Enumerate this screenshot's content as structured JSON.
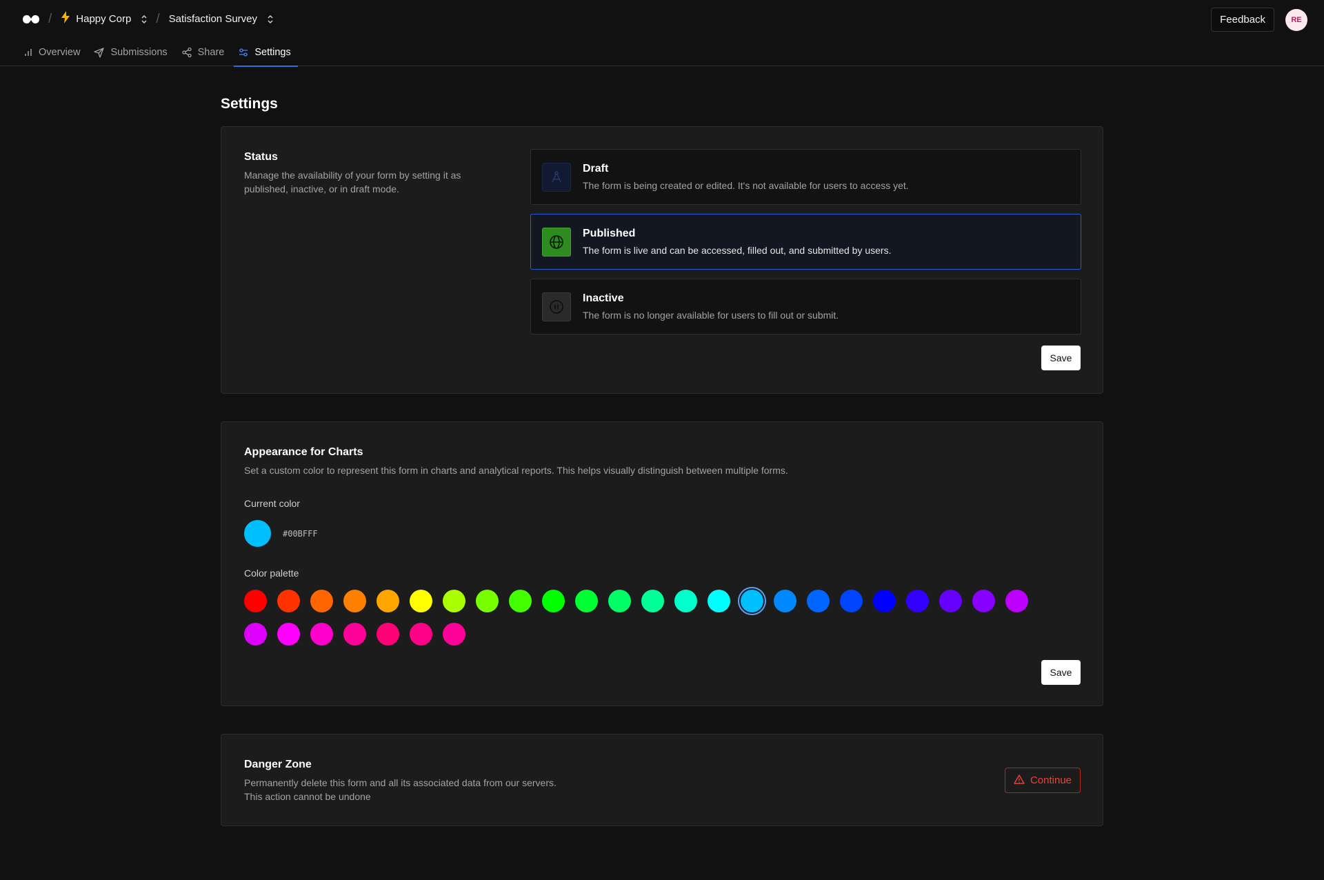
{
  "header": {
    "logo_icon": "infinity-logo-icon",
    "org": {
      "icon": "bolt-icon",
      "name": "Happy Corp"
    },
    "form": {
      "name": "Satisfaction Survey"
    },
    "feedback_label": "Feedback",
    "avatar_initials": "RE"
  },
  "tabs": [
    {
      "label": "Overview",
      "icon": "bar-chart-icon",
      "active": false
    },
    {
      "label": "Submissions",
      "icon": "send-icon",
      "active": false
    },
    {
      "label": "Share",
      "icon": "share-icon",
      "active": false
    },
    {
      "label": "Settings",
      "icon": "settings-sliders-icon",
      "active": true
    }
  ],
  "page_title": "Settings",
  "status": {
    "title": "Status",
    "description": "Manage the availability of your form by setting it as published, inactive, or in draft mode.",
    "options": [
      {
        "title": "Draft",
        "description": "The form is being created or edited. It's not available for users to access yet.",
        "icon": "compass-icon",
        "selected": false
      },
      {
        "title": "Published",
        "description": "The form is live and can be accessed, filled out, and submitted by users.",
        "icon": "globe-icon",
        "selected": true
      },
      {
        "title": "Inactive",
        "description": "The form is no longer available for users to fill out or submit.",
        "icon": "pause-circle-icon",
        "selected": false
      }
    ],
    "save_label": "Save"
  },
  "appearance": {
    "title": "Appearance for Charts",
    "description": "Set a custom color to represent this form in charts and analytical reports. This helps visually distinguish between multiple forms.",
    "current_color_label": "Current color",
    "current_color": "#00BFFF",
    "palette_label": "Color palette",
    "palette": [
      "#FF0000",
      "#FF3300",
      "#FF6600",
      "#FF8000",
      "#FFA500",
      "#FFFF00",
      "#AAFF00",
      "#77FF00",
      "#44FF00",
      "#00FF00",
      "#00FF33",
      "#00FF66",
      "#00FF99",
      "#00FFCC",
      "#00FFFF",
      "#00BFFF",
      "#0088FF",
      "#0066FF",
      "#0044FF",
      "#0000FF",
      "#3300FF",
      "#6600FF",
      "#8800FF",
      "#BB00FF",
      "#DD00FF",
      "#FF00FF",
      "#FF00CC",
      "#FF0099",
      "#FF0077",
      "#FF0088",
      "#FF0099"
    ],
    "selected_index": 15,
    "save_label": "Save"
  },
  "danger": {
    "title": "Danger Zone",
    "description": "Permanently delete this form and all its associated data from our servers. This action cannot be undone",
    "button_label": "Continue",
    "button_icon": "warning-triangle-icon",
    "accent": "#EF4136"
  }
}
